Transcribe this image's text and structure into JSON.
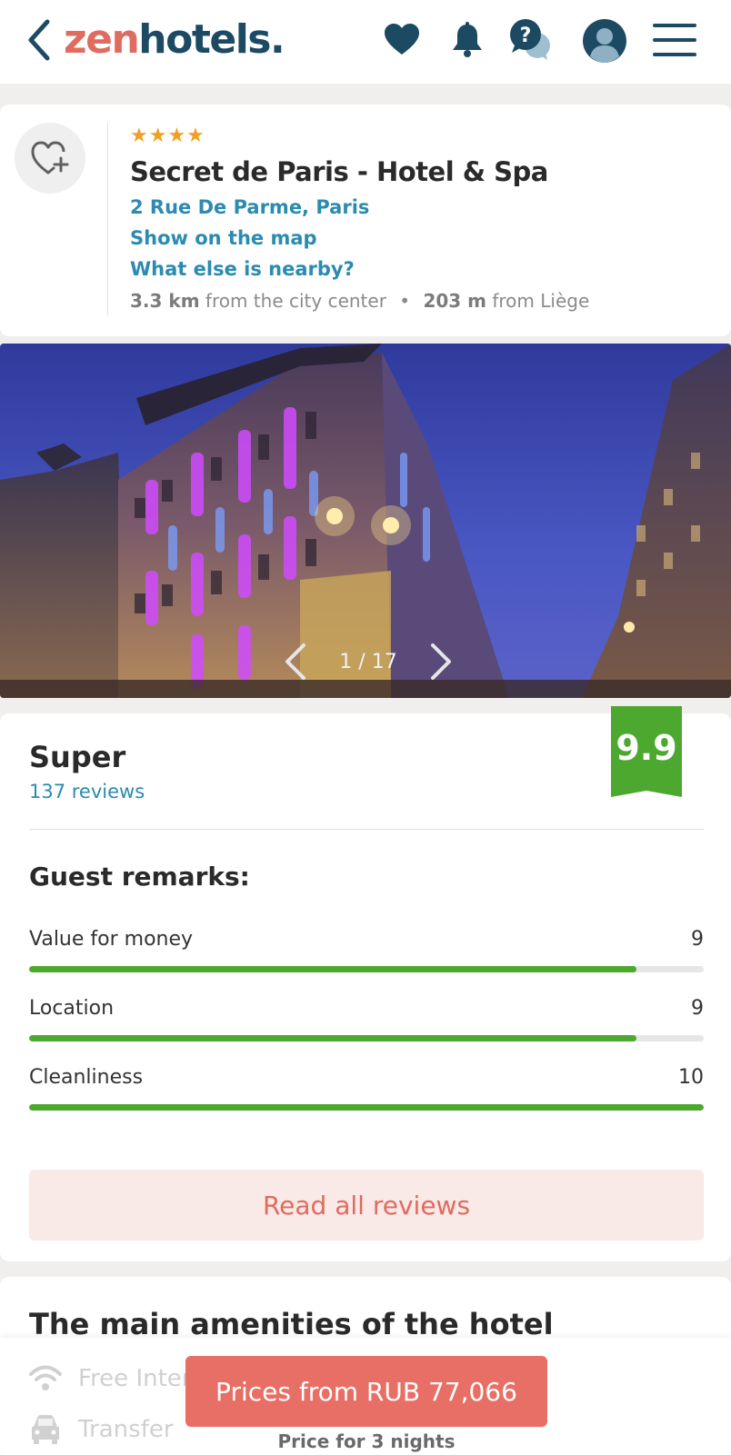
{
  "header": {
    "logo_zen": "zen",
    "logo_hotels": "hotels",
    "logo_dot": ".",
    "icons": [
      "back-chevron-icon",
      "heart-icon",
      "bell-icon",
      "help-chat-icon",
      "user-avatar-icon",
      "hamburger-menu-icon"
    ],
    "brand_colors": {
      "zen": "#e06b5f",
      "hotels": "#1d4a63"
    }
  },
  "hotel": {
    "stars": "★★★★",
    "star_count": 4,
    "name": "Secret de Paris - Hotel & Spa",
    "address": "2 Rue De Parme, Paris",
    "show_map": "Show on the map",
    "nearby": "What else is nearby?",
    "distance_city_value": "3.3 km",
    "distance_city_text": "from the city center",
    "distance_poi_value": "203 m",
    "distance_poi_text": "from Liège",
    "separator": "•"
  },
  "gallery": {
    "counter": "1 / 17",
    "current": 1,
    "total": 17
  },
  "reviews": {
    "rating_word": "Super",
    "review_count": "137 reviews",
    "score": "9.9",
    "remarks_title": "Guest remarks:",
    "remarks": [
      {
        "label": "Value for money",
        "value": "9",
        "fraction": 0.9
      },
      {
        "label": "Location",
        "value": "9",
        "fraction": 0.9
      },
      {
        "label": "Cleanliness",
        "value": "10",
        "fraction": 1.0
      }
    ],
    "read_all": "Read all reviews",
    "accent_green": "#4ca82e"
  },
  "amenities": {
    "title": "The main amenities of the hotel",
    "items": [
      {
        "icon": "wifi-icon",
        "label": "Free Internet"
      },
      {
        "icon": "car-icon",
        "label": "Transfer"
      }
    ]
  },
  "cta": {
    "price_label": "Prices from RUB 77,066",
    "price_note": "Price for 3 nights",
    "color": "#e86f66"
  }
}
